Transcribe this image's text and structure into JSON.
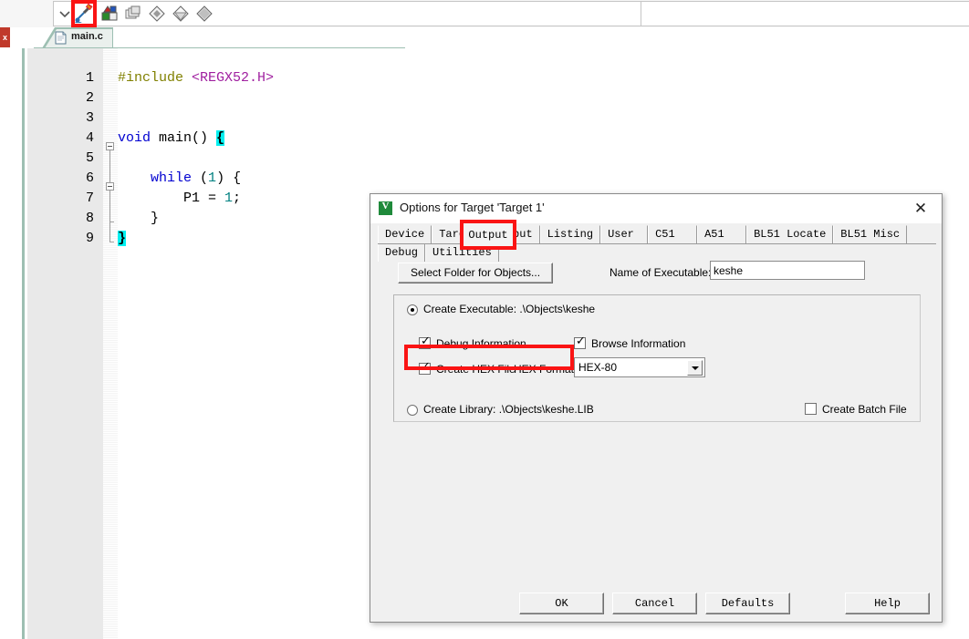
{
  "toolbar": {
    "icons": [
      {
        "name": "chevron-down-icon",
        "label": "Toolbar overflow"
      },
      {
        "name": "build-target-icon",
        "label": "Build target (highlighted)"
      },
      {
        "name": "options-for-target-icon",
        "label": "Options for Target"
      },
      {
        "name": "manage-project-items-icon",
        "label": "Manage Project Items"
      },
      {
        "name": "target-selector-icon-1",
        "label": "Target"
      },
      {
        "name": "target-selector-icon-2",
        "label": "Target"
      },
      {
        "name": "target-selector-icon-3",
        "label": "Target"
      }
    ]
  },
  "left_stub": {
    "label": "x"
  },
  "editor": {
    "tab": {
      "label": "main.c",
      "icon": "document-icon"
    },
    "lines": [
      {
        "n": "1",
        "tokens": [
          {
            "t": "#include ",
            "c": "pre"
          },
          {
            "t": "<REGX52.H>",
            "c": "hdr"
          }
        ]
      },
      {
        "n": "2",
        "tokens": []
      },
      {
        "n": "3",
        "tokens": []
      },
      {
        "n": "4",
        "tokens": [
          {
            "t": "void",
            "c": "kw"
          },
          {
            "t": " main() ",
            "c": "pln"
          },
          {
            "t": "{",
            "c": "brace-hl"
          }
        ]
      },
      {
        "n": "5",
        "tokens": []
      },
      {
        "n": "6",
        "tokens": [
          {
            "t": "    ",
            "c": "pln"
          },
          {
            "t": "while",
            "c": "kw"
          },
          {
            "t": " (",
            "c": "pln"
          },
          {
            "t": "1",
            "c": "num"
          },
          {
            "t": ") {",
            "c": "pln"
          }
        ]
      },
      {
        "n": "7",
        "tokens": [
          {
            "t": "        P1 = ",
            "c": "pln"
          },
          {
            "t": "1",
            "c": "num"
          },
          {
            "t": ";",
            "c": "pln"
          }
        ]
      },
      {
        "n": "8",
        "tokens": [
          {
            "t": "    }",
            "c": "pln"
          }
        ]
      },
      {
        "n": "9",
        "tokens": [
          {
            "t": "}",
            "c": "brace-hl"
          }
        ]
      }
    ]
  },
  "dialog": {
    "title": "Options for Target 'Target 1'",
    "icon_letter": "V",
    "close_glyph": "✕",
    "tabs": [
      {
        "label": "Device",
        "selected": false
      },
      {
        "label": "Target",
        "selected": false
      },
      {
        "label": "Output",
        "selected": true
      },
      {
        "label": "Listing",
        "selected": false
      },
      {
        "label": "User",
        "selected": false
      },
      {
        "label": "C51",
        "selected": false
      },
      {
        "label": "A51",
        "selected": false
      },
      {
        "label": "BL51 Locate",
        "selected": false
      },
      {
        "label": "BL51 Misc",
        "selected": false
      },
      {
        "label": "Debug",
        "selected": false
      },
      {
        "label": "Utilities",
        "selected": false
      }
    ],
    "select_folder_button": "Select Folder for Objects...",
    "name_of_executable_label": "Name of Executable:",
    "name_of_executable_value": "keshe",
    "create_executable_label": "Create Executable:  .\\Objects\\keshe",
    "create_executable_checked": true,
    "debug_information_label": "Debug Information",
    "debug_information_checked": true,
    "browse_information_label": "Browse Information",
    "browse_information_checked": true,
    "create_hex_file_label": "Create HEX File",
    "create_hex_file_checked": true,
    "hex_format_label": "HEX Format:",
    "hex_format_value": "HEX-80",
    "create_library_label": "Create Library:  .\\Objects\\keshe.LIB",
    "create_library_checked": false,
    "create_batch_file_label": "Create Batch File",
    "create_batch_file_checked": false,
    "buttons": {
      "ok": "OK",
      "cancel": "Cancel",
      "defaults": "Defaults",
      "help": "Help"
    }
  },
  "annotations": {
    "highlight_color": "#fa1414",
    "boxes": [
      {
        "name": "toolbar-build-highlight"
      },
      {
        "name": "output-tab-highlight"
      },
      {
        "name": "create-hex-file-highlight"
      }
    ]
  }
}
